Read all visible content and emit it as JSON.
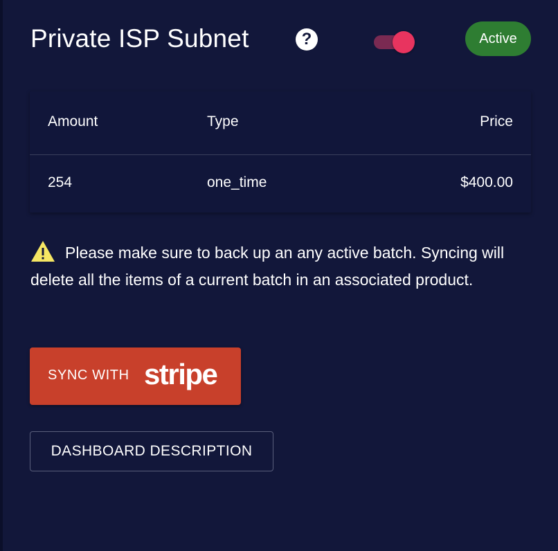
{
  "header": {
    "title": "Private ISP Subnet",
    "help_icon": "?",
    "toggle_on": true,
    "status": "Active",
    "status_color": "#2e7d32",
    "toggle_color": "#e8345f"
  },
  "table": {
    "columns": [
      "Amount",
      "Type",
      "Price"
    ],
    "rows": [
      {
        "amount": "254",
        "type": "one_time",
        "price": "$400.00"
      }
    ]
  },
  "warning": {
    "icon": "warning-icon",
    "text": "Please make sure to back up an any active batch. Syncing will delete all the items of a current batch in an associated product."
  },
  "buttons": {
    "sync_label": "SYNC WITH",
    "sync_brand": "stripe",
    "sync_color": "#c8402b",
    "dashboard_label": "DASHBOARD DESCRIPTION"
  }
}
